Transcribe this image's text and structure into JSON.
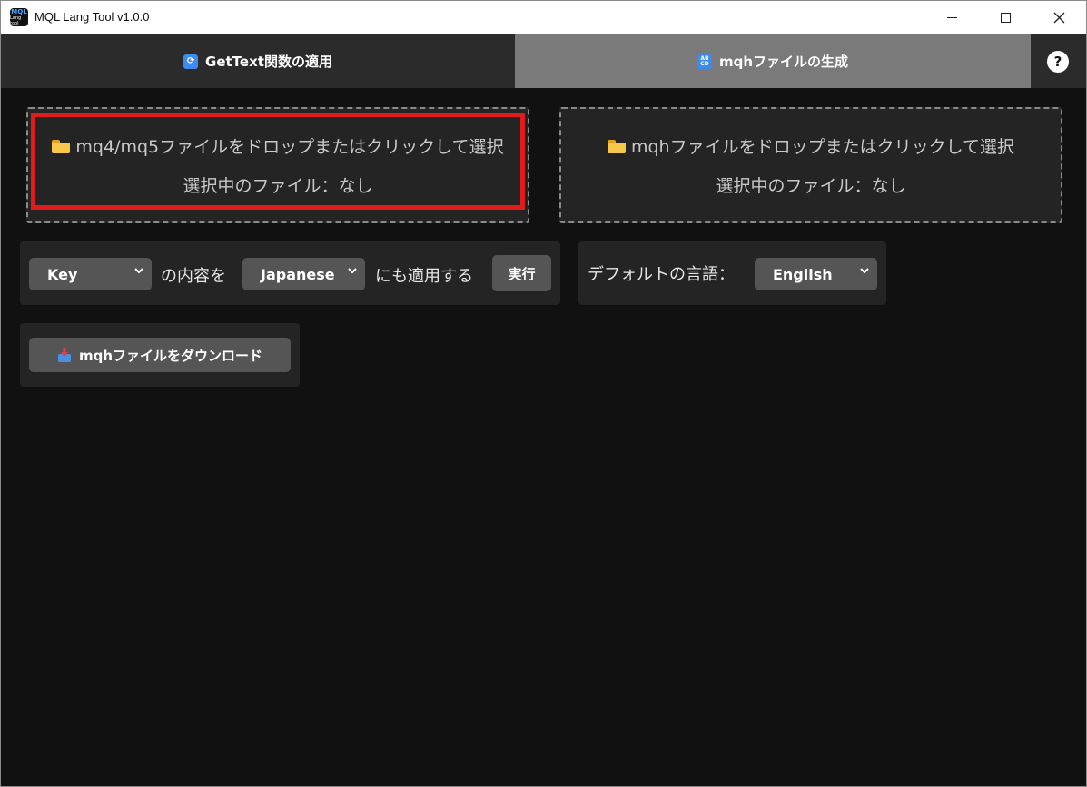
{
  "window": {
    "title": "MQL Lang Tool v1.0.0",
    "icon_line1": "MQL",
    "icon_line2": "Lang tool"
  },
  "tabs": [
    {
      "label": "GetText関数の適用",
      "icon": "refresh-icon",
      "active": false
    },
    {
      "label": "mqhファイルの生成",
      "icon": "abcd-icon",
      "active": true
    }
  ],
  "help": {
    "label": "?"
  },
  "dropzones": [
    {
      "prompt": "mq4/mq5ファイルをドロップまたはクリックして選択",
      "status": "選択中のファイル：なし"
    },
    {
      "prompt": "mqhファイルをドロップまたはクリックして選択",
      "status": "選択中のファイル：なし"
    }
  ],
  "apply_panel": {
    "source_select": "Key",
    "label_middle": "の内容を",
    "target_select": "Japanese",
    "label_end": "にも適用する",
    "run_button": "実行"
  },
  "default_panel": {
    "label": "デフォルトの言語：",
    "language_select": "English"
  },
  "download": {
    "button": "mqhファイルをダウンロード"
  },
  "colors": {
    "background": "#111111",
    "panel": "#242424",
    "active_tab": "#7a7a7a",
    "highlight": "#e11b1b",
    "folder": "#f7c74a"
  }
}
